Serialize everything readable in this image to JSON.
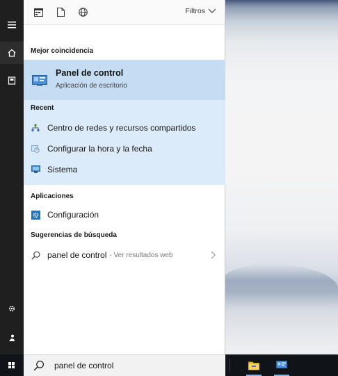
{
  "top_bar": {
    "filters_label": "Filtros",
    "icons": [
      "apps-icon",
      "document-icon",
      "web-icon"
    ]
  },
  "best_match": {
    "section": "Mejor coincidencia",
    "title": "Panel de control",
    "subtitle": "Aplicación de escritorio",
    "icon": "control-panel-icon"
  },
  "recent": {
    "section": "Recent",
    "items": [
      {
        "label": "Centro de redes y recursos compartidos",
        "icon": "network-icon"
      },
      {
        "label": "Configurar la hora y la fecha",
        "icon": "clock-settings-icon"
      },
      {
        "label": "Sistema",
        "icon": "system-icon"
      }
    ]
  },
  "apps": {
    "section": "Aplicaciones",
    "items": [
      {
        "label": "Configuración",
        "icon": "settings-app-icon"
      }
    ]
  },
  "suggestions": {
    "section": "Sugerencias de búsqueda",
    "items": [
      {
        "label": "panel de control",
        "sub": "- Ver resultados web",
        "icon": "search-icon"
      }
    ]
  },
  "search": {
    "value": "panel de control"
  },
  "colors": {
    "rail": "#1f1f1f",
    "best_match_bg": "#c5ddf3",
    "recent_bg": "#dcebf9",
    "taskbar": "#101418"
  }
}
